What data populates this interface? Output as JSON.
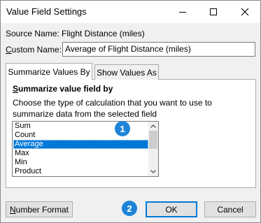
{
  "window": {
    "title": "Value Field Settings"
  },
  "source": {
    "label": "Source Name:",
    "value": "Flight Distance (miles)"
  },
  "custom": {
    "label_first": "C",
    "label_rest": "ustom Name:",
    "value": "Average of Flight Distance (miles)"
  },
  "tabs": [
    {
      "label": "Summarize Values By",
      "active": true
    },
    {
      "label": "Show Values As",
      "active": false
    }
  ],
  "panel": {
    "heading_first": "S",
    "heading_rest": "ummarize value field by",
    "description": "Choose the type of calculation that you want to use to summarize data from the selected field"
  },
  "list": {
    "items": [
      "Sum",
      "Count",
      "Average",
      "Max",
      "Min",
      "Product"
    ],
    "selected": "Average"
  },
  "badges": [
    "1",
    "2"
  ],
  "buttons": {
    "number_format_first": "N",
    "number_format_rest": "umber Format",
    "ok": "OK",
    "cancel": "Cancel"
  },
  "colors": {
    "accent": "#0078d7",
    "badge": "#1f84d8"
  },
  "icons": [
    "minimize-icon",
    "maximize-icon",
    "close-icon",
    "scroll-up-icon",
    "scroll-down-icon"
  ]
}
